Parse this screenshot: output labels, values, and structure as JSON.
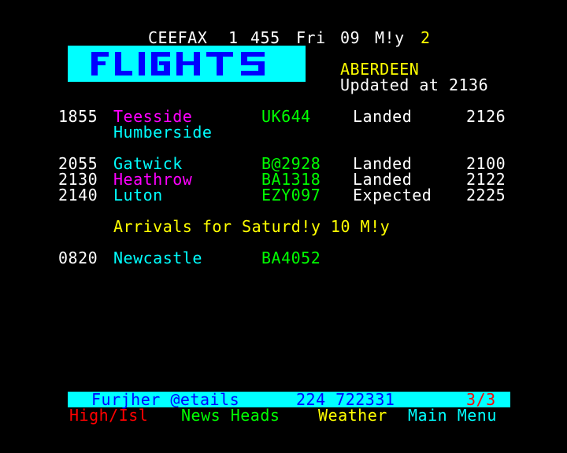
{
  "header": {
    "service": "CEEFAX",
    "magazine": "1",
    "page": "455",
    "day": "Fri",
    "date": "09",
    "month": "M!y",
    "clock_digit": "2"
  },
  "logo": {
    "text": "FLIGHTS",
    "colors": {
      "background": "#00ffff",
      "letters": "#0000ff"
    }
  },
  "airport": {
    "name": "ABERDEEN",
    "updated": "Updated at 2136"
  },
  "flights": [
    {
      "time": "1855",
      "origin": "Teesside",
      "via": "Humberside",
      "flight": "UK644",
      "status": "Landed",
      "actual": "2126",
      "origin_color": "#ff00ff"
    },
    {
      "time": "2055",
      "origin": "Gatwick",
      "via": "",
      "flight": "B@2928",
      "status": "Landed",
      "actual": "2100",
      "origin_color": "#00ffff"
    },
    {
      "time": "2130",
      "origin": "Heathrow",
      "via": "",
      "flight": "BA1318",
      "status": "Landed",
      "actual": "2122",
      "origin_color": "#ff00ff"
    },
    {
      "time": "2140",
      "origin": "Luton",
      "via": "",
      "flight": "EZY097",
      "status": "Expected",
      "actual": "2225",
      "origin_color": "#00ffff"
    }
  ],
  "next_day": {
    "heading": "Arrivals for Saturd!y 10 M!y",
    "flights": [
      {
        "time": "0820",
        "origin": "Newcastle",
        "flight": "BA4052",
        "status": "",
        "actual": ""
      }
    ]
  },
  "bottom_bar": {
    "label": "Furjher @etails",
    "phone": "224 722331",
    "subpage": "3/3"
  },
  "fastext": {
    "red": "High/Isl",
    "green": "News Heads",
    "yellow": "Weather",
    "cyan": "Main Menu"
  },
  "colors": {
    "background": "#000000",
    "header_text": "#ffffff",
    "accent_yellow": "#ffff00",
    "accent_cyan": "#00ffff",
    "accent_magenta": "#ff00ff",
    "accent_green": "#00ff00",
    "accent_red": "#ff0000"
  }
}
